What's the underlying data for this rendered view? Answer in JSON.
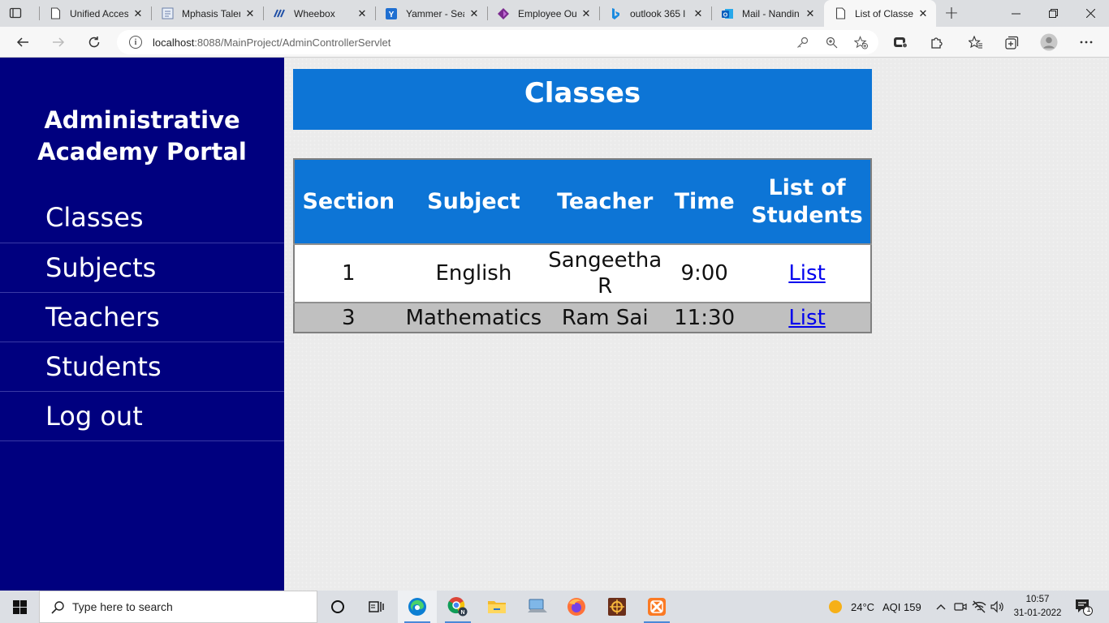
{
  "browser": {
    "tabs": [
      {
        "title": "Unified Acces",
        "icon": "page-icon",
        "active": false
      },
      {
        "title": "Mphasis Talen",
        "icon": "document-icon",
        "active": false
      },
      {
        "title": "Wheebox",
        "icon": "wheebox-icon",
        "active": false
      },
      {
        "title": "Yammer - Sea",
        "icon": "yammer-icon",
        "active": false
      },
      {
        "title": "Employee Ou",
        "icon": "powerapps-icon",
        "active": false
      },
      {
        "title": "outlook 365 l",
        "icon": "bing-icon",
        "active": false
      },
      {
        "title": "Mail - Nandin",
        "icon": "outlook-icon",
        "active": false
      },
      {
        "title": "List of Classes",
        "icon": "page-icon",
        "active": true
      }
    ],
    "url_host": "localhost",
    "url_rest": ":8088/MainProject/AdminControllerServlet"
  },
  "sidebar": {
    "title_line1": "Administrative",
    "title_line2": "Academy Portal",
    "items": [
      {
        "label": "Classes"
      },
      {
        "label": "Subjects"
      },
      {
        "label": "Teachers"
      },
      {
        "label": "Students"
      },
      {
        "label": "Log out"
      }
    ]
  },
  "main": {
    "heading": "Classes",
    "table": {
      "headers": [
        "Section",
        "Subject",
        "Teacher",
        "Time",
        "List of Students"
      ],
      "rows": [
        {
          "section": "1",
          "subject": "English",
          "teacher": "Sangeetha R",
          "time": "9:00",
          "link": "List"
        },
        {
          "section": "3",
          "subject": "Mathematics",
          "teacher": "Ram Sai",
          "time": "11:30",
          "link": "List"
        }
      ]
    }
  },
  "taskbar": {
    "search_placeholder": "Type here to search",
    "weather": "24°C",
    "aqi": "AQI 159",
    "time": "10:57",
    "date": "31-01-2022",
    "notification_count": "1"
  },
  "colors": {
    "sidebar_bg": "#00007f",
    "header_blue": "#0d75d6",
    "alt_row": "#c0c0c0",
    "link": "#0000ee"
  }
}
